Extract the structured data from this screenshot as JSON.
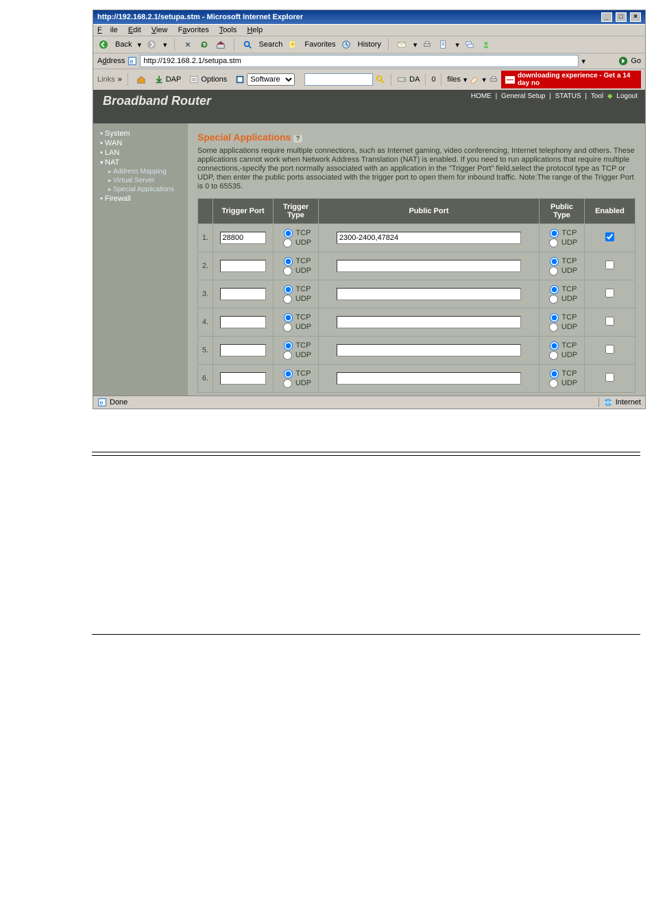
{
  "ie": {
    "title": "http://192.168.2.1/setupa.stm - Microsoft Internet Explorer",
    "menubar": {
      "file": "File",
      "edit": "Edit",
      "view": "View",
      "favorites": "Favorites",
      "tools": "Tools",
      "help": "Help"
    },
    "toolbar": {
      "back": "Back",
      "search": "Search",
      "favorites": "Favorites",
      "history": "History"
    },
    "address_label": "Address",
    "address_value": "http://192.168.2.1/setupa.stm",
    "go_label": "Go",
    "links_label": "Links",
    "links": {
      "dap": "DAP",
      "options": "Options",
      "software": "Software"
    },
    "promo": "downloading experience - Get a 14 day no",
    "toolbar2": {
      "da": "DA",
      "zero": "0",
      "files": "files"
    },
    "status_done": "Done",
    "status_zone": "Internet"
  },
  "router": {
    "brand": "Broadband Router",
    "nav": {
      "home": "HOME",
      "general": "General Setup",
      "status": "STATUS",
      "tool": "Tool",
      "logout": "Logout"
    }
  },
  "sidebar": {
    "system": "System",
    "wan": "WAN",
    "lan": "LAN",
    "nat": "NAT",
    "addrmap": "Address Mapping",
    "vserver": "Virtual Server",
    "spapps": "Special Applications",
    "firewall": "Firewall"
  },
  "page": {
    "title": "Special Applications",
    "help": "?",
    "desc": "Some applications require multiple connections, such as Internet gaming, video conferencing, Internet telephony and others. These applications cannot work when Network Address Translation (NAT) is enabled. If you need to run applications that require multiple connections,-specify the port normally associated with an application in the \"Trigger Port\" field,select the protocol type as TCP or UDP, then enter the public ports associated with the trigger port to open them for inbound traffic. Note:The range of the Trigger Port is 0 to 65535."
  },
  "table": {
    "th": {
      "trigport": "Trigger Port",
      "trigtype": "Trigger Type",
      "pubport": "Public Port",
      "pubtype": "Public Type",
      "enabled": "Enabled"
    },
    "proto": {
      "tcp": "TCP",
      "udp": "UDP"
    },
    "rows": [
      {
        "idx": "1.",
        "trigport": "28800",
        "trigtype": "TCP",
        "pubport": "2300-2400,47824",
        "pubtype": "TCP",
        "enabled": true
      },
      {
        "idx": "2.",
        "trigport": "",
        "trigtype": "TCP",
        "pubport": "",
        "pubtype": "TCP",
        "enabled": false
      },
      {
        "idx": "3.",
        "trigport": "",
        "trigtype": "TCP",
        "pubport": "",
        "pubtype": "TCP",
        "enabled": false
      },
      {
        "idx": "4.",
        "trigport": "",
        "trigtype": "TCP",
        "pubport": "",
        "pubtype": "TCP",
        "enabled": false
      },
      {
        "idx": "5.",
        "trigport": "",
        "trigtype": "TCP",
        "pubport": "",
        "pubtype": "TCP",
        "enabled": false
      },
      {
        "idx": "6.",
        "trigport": "",
        "trigtype": "TCP",
        "pubport": "",
        "pubtype": "TCP",
        "enabled": false
      }
    ]
  }
}
